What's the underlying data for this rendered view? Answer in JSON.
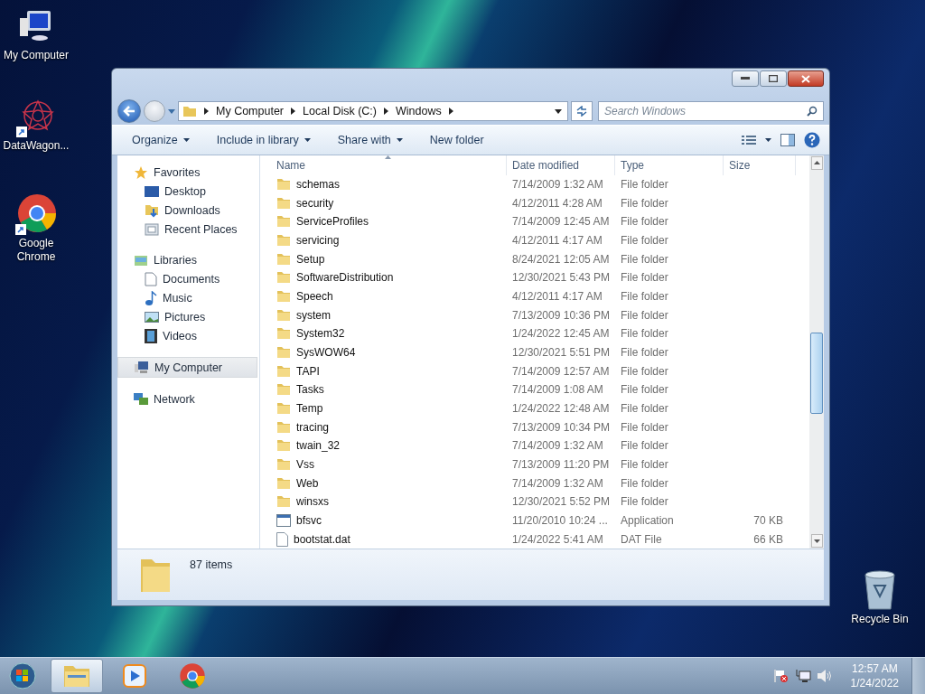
{
  "desktop_icons": [
    {
      "label": "My Computer",
      "kind": "computer",
      "shortcut": false
    },
    {
      "label": "DataWagon...",
      "kind": "star",
      "shortcut": true
    },
    {
      "label": "Google Chrome",
      "kind": "chrome",
      "shortcut": true
    },
    {
      "label": "Recycle Bin",
      "kind": "bin",
      "shortcut": false
    }
  ],
  "window": {
    "address": [
      "My Computer",
      "Local Disk (C:)",
      "Windows"
    ],
    "search": {
      "placeholder": "Search Windows"
    },
    "toolbar": [
      {
        "label": "Organize",
        "dropdown": true
      },
      {
        "label": "Include in library",
        "dropdown": true
      },
      {
        "label": "Share with",
        "dropdown": true
      },
      {
        "label": "New folder",
        "dropdown": false
      }
    ],
    "sidebar": [
      {
        "label": "Favorites",
        "kind": "star",
        "selected": false,
        "children": [
          {
            "label": "Desktop",
            "kind": "desktop",
            "selected": false
          },
          {
            "label": "Downloads",
            "kind": "downloads",
            "selected": false
          },
          {
            "label": "Recent Places",
            "kind": "recent",
            "selected": false
          }
        ]
      },
      {
        "label": "Libraries",
        "kind": "library",
        "selected": false,
        "children": [
          {
            "label": "Documents",
            "kind": "document",
            "selected": false
          },
          {
            "label": "Music",
            "kind": "music",
            "selected": false
          },
          {
            "label": "Pictures",
            "kind": "picture",
            "selected": false
          },
          {
            "label": "Videos",
            "kind": "video",
            "selected": false
          }
        ]
      },
      {
        "label": "My Computer",
        "kind": "computer",
        "selected": true
      },
      {
        "label": "Network",
        "kind": "network",
        "selected": false
      }
    ],
    "columns": [
      {
        "label": "Name",
        "sorted": true
      },
      {
        "label": "Date modified",
        "sorted": false
      },
      {
        "label": "Type",
        "sorted": false
      },
      {
        "label": "Size",
        "sorted": false
      }
    ],
    "rows": [
      {
        "name": "schemas",
        "date": "7/14/2009 1:32 AM",
        "type": "File folder",
        "kind": "folder"
      },
      {
        "name": "security",
        "date": "4/12/2011 4:28 AM",
        "type": "File folder",
        "kind": "folder"
      },
      {
        "name": "ServiceProfiles",
        "date": "7/14/2009 12:45 AM",
        "type": "File folder",
        "kind": "folder"
      },
      {
        "name": "servicing",
        "date": "4/12/2011 4:17 AM",
        "type": "File folder",
        "kind": "folder"
      },
      {
        "name": "Setup",
        "date": "8/24/2021 12:05 AM",
        "type": "File folder",
        "kind": "folder"
      },
      {
        "name": "SoftwareDistribution",
        "date": "12/30/2021 5:43 PM",
        "type": "File folder",
        "kind": "folder"
      },
      {
        "name": "Speech",
        "date": "4/12/2011 4:17 AM",
        "type": "File folder",
        "kind": "folder"
      },
      {
        "name": "system",
        "date": "7/13/2009 10:36 PM",
        "type": "File folder",
        "kind": "folder"
      },
      {
        "name": "System32",
        "date": "1/24/2022 12:45 AM",
        "type": "File folder",
        "kind": "folder"
      },
      {
        "name": "SysWOW64",
        "date": "12/30/2021 5:51 PM",
        "type": "File folder",
        "kind": "folder"
      },
      {
        "name": "TAPI",
        "date": "7/14/2009 12:57 AM",
        "type": "File folder",
        "kind": "folder"
      },
      {
        "name": "Tasks",
        "date": "7/14/2009 1:08 AM",
        "type": "File folder",
        "kind": "folder"
      },
      {
        "name": "Temp",
        "date": "1/24/2022 12:48 AM",
        "type": "File folder",
        "kind": "folder"
      },
      {
        "name": "tracing",
        "date": "7/13/2009 10:34 PM",
        "type": "File folder",
        "kind": "folder"
      },
      {
        "name": "twain_32",
        "date": "7/14/2009 1:32 AM",
        "type": "File folder",
        "kind": "folder"
      },
      {
        "name": "Vss",
        "date": "7/13/2009 11:20 PM",
        "type": "File folder",
        "kind": "folder"
      },
      {
        "name": "Web",
        "date": "7/14/2009 1:32 AM",
        "type": "File folder",
        "kind": "folder"
      },
      {
        "name": "winsxs",
        "date": "12/30/2021 5:52 PM",
        "type": "File folder",
        "kind": "folder"
      },
      {
        "name": "bfsvc",
        "date": "11/20/2010 10:24 ...",
        "type": "Application",
        "size": "70 KB",
        "kind": "application"
      },
      {
        "name": "bootstat.dat",
        "date": "1/24/2022 5:41 AM",
        "type": "DAT File",
        "size": "66 KB",
        "kind": "file"
      }
    ],
    "status": "87 items"
  },
  "taskbar": {
    "apps": [
      {
        "kind": "explorer",
        "selected": true
      },
      {
        "kind": "media",
        "selected": false
      },
      {
        "kind": "chrome",
        "selected": false
      }
    ],
    "time": "12:57 AM",
    "date": "1/24/2022"
  }
}
